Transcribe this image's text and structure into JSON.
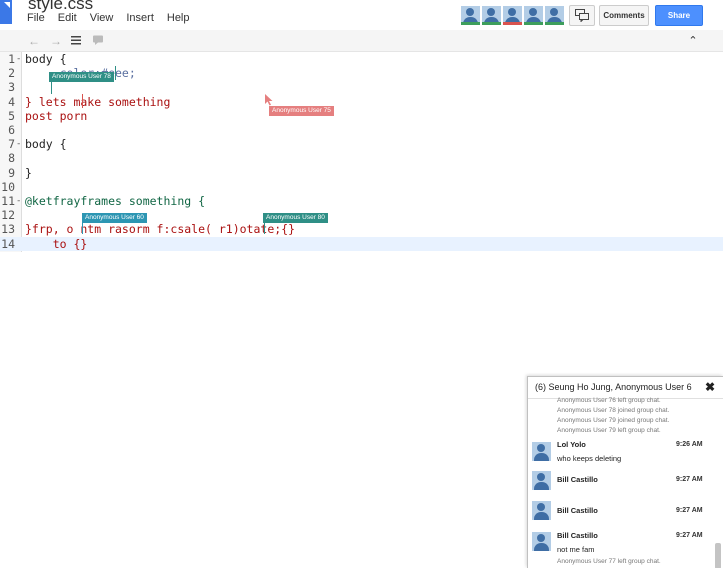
{
  "header": {
    "doc_title": "style.css",
    "menu": [
      "File",
      "Edit",
      "View",
      "Insert",
      "Help"
    ],
    "avatar_colors": [
      "#3d9e5c",
      "#3d9e5c",
      "#d9534f",
      "#3d9e5c",
      "#3d9e5c"
    ],
    "comments_label": "Comments",
    "share_label": "Share"
  },
  "toolbar": {
    "icons": [
      "back-arrow-icon",
      "forward-arrow-icon",
      "list-icon",
      "comment-icon",
      "collapse-icon"
    ]
  },
  "editor": {
    "active_line": 14,
    "lines": [
      {
        "num": "1",
        "fold": "-",
        "text": "body {"
      },
      {
        "num": "2",
        "fold": "",
        "text": "    -color:#eee;"
      },
      {
        "num": "3",
        "fold": "",
        "text": ""
      },
      {
        "num": "4",
        "fold": "",
        "text": "} lets make something"
      },
      {
        "num": "5",
        "fold": "",
        "text": "post porn"
      },
      {
        "num": "6",
        "fold": "",
        "text": ""
      },
      {
        "num": "7",
        "fold": "-",
        "text": "body {"
      },
      {
        "num": "8",
        "fold": "",
        "text": ""
      },
      {
        "num": "9",
        "fold": "",
        "text": "}"
      },
      {
        "num": "10",
        "fold": "",
        "text": ""
      },
      {
        "num": "11",
        "fold": "-",
        "text": "@ketfrayframes something {"
      },
      {
        "num": "12",
        "fold": "",
        "text": ""
      },
      {
        "num": "13",
        "fold": "",
        "text": "}frp, o ntm rasorm f:csale( r1)otate;{}"
      },
      {
        "num": "14",
        "fold": "",
        "text": "    to {}"
      }
    ],
    "collaborator_flags": [
      {
        "label": "Anonymous User 78",
        "color": "#2f8f86"
      },
      {
        "label": "Anonymous User 75",
        "color": "#e57f7f"
      },
      {
        "label": "Anonymous User 60",
        "color": "#2d96b3"
      },
      {
        "label": "Anonymous User 80",
        "color": "#2f8f86"
      }
    ]
  },
  "chat": {
    "count": "(6)",
    "title": "Seung Ho Jung, Anonymous User 6",
    "system_top": [
      "Anonymous User 76 left group chat.",
      "Anonymous User 78 joined group chat.",
      "Anonymous User 79 joined group chat.",
      "Anonymous User 79 left group chat."
    ],
    "messages": [
      {
        "name": "Lol Yolo",
        "time": "9:26 AM",
        "text": "who keeps deleting"
      },
      {
        "name": "Bill Castillo",
        "time": "9:27 AM",
        "text": ""
      },
      {
        "name": "Bill Castillo",
        "time": "9:27 AM",
        "text": ""
      },
      {
        "name": "Bill Castillo",
        "time": "9:27 AM",
        "text": "not me fam"
      }
    ],
    "system_bottom": "Anonymous User 77 left group chat."
  }
}
